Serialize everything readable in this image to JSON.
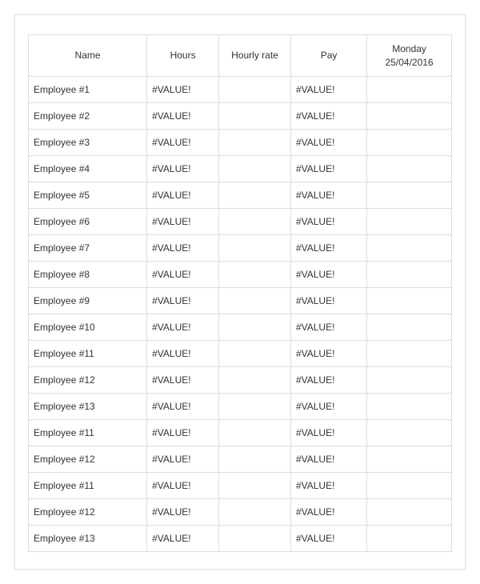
{
  "table": {
    "headers": {
      "name": "Name",
      "hours": "Hours",
      "rate": "Hourly rate",
      "pay": "Pay",
      "date_top": "Monday",
      "date_bottom": "25/04/2016"
    },
    "rows": [
      {
        "name": "Employee #1",
        "hours": "#VALUE!",
        "rate": "",
        "pay": "#VALUE!",
        "date": ""
      },
      {
        "name": "Employee #2",
        "hours": "#VALUE!",
        "rate": "",
        "pay": "#VALUE!",
        "date": ""
      },
      {
        "name": "Employee #3",
        "hours": "#VALUE!",
        "rate": "",
        "pay": "#VALUE!",
        "date": ""
      },
      {
        "name": "Employee #4",
        "hours": "#VALUE!",
        "rate": "",
        "pay": "#VALUE!",
        "date": ""
      },
      {
        "name": "Employee #5",
        "hours": "#VALUE!",
        "rate": "",
        "pay": "#VALUE!",
        "date": ""
      },
      {
        "name": "Employee #6",
        "hours": "#VALUE!",
        "rate": "",
        "pay": "#VALUE!",
        "date": ""
      },
      {
        "name": "Employee #7",
        "hours": "#VALUE!",
        "rate": "",
        "pay": "#VALUE!",
        "date": ""
      },
      {
        "name": "Employee #8",
        "hours": "#VALUE!",
        "rate": "",
        "pay": "#VALUE!",
        "date": ""
      },
      {
        "name": "Employee #9",
        "hours": "#VALUE!",
        "rate": "",
        "pay": "#VALUE!",
        "date": ""
      },
      {
        "name": "Employee #10",
        "hours": "#VALUE!",
        "rate": "",
        "pay": "#VALUE!",
        "date": ""
      },
      {
        "name": "Employee #11",
        "hours": "#VALUE!",
        "rate": "",
        "pay": "#VALUE!",
        "date": ""
      },
      {
        "name": "Employee #12",
        "hours": "#VALUE!",
        "rate": "",
        "pay": "#VALUE!",
        "date": ""
      },
      {
        "name": "Employee #13",
        "hours": "#VALUE!",
        "rate": "",
        "pay": "#VALUE!",
        "date": ""
      },
      {
        "name": "Employee #11",
        "hours": "#VALUE!",
        "rate": "",
        "pay": "#VALUE!",
        "date": ""
      },
      {
        "name": "Employee #12",
        "hours": "#VALUE!",
        "rate": "",
        "pay": "#VALUE!",
        "date": ""
      },
      {
        "name": "Employee #11",
        "hours": "#VALUE!",
        "rate": "",
        "pay": "#VALUE!",
        "date": ""
      },
      {
        "name": "Employee #12",
        "hours": "#VALUE!",
        "rate": "",
        "pay": "#VALUE!",
        "date": ""
      },
      {
        "name": "Employee #13",
        "hours": "#VALUE!",
        "rate": "",
        "pay": "#VALUE!",
        "date": ""
      }
    ]
  }
}
